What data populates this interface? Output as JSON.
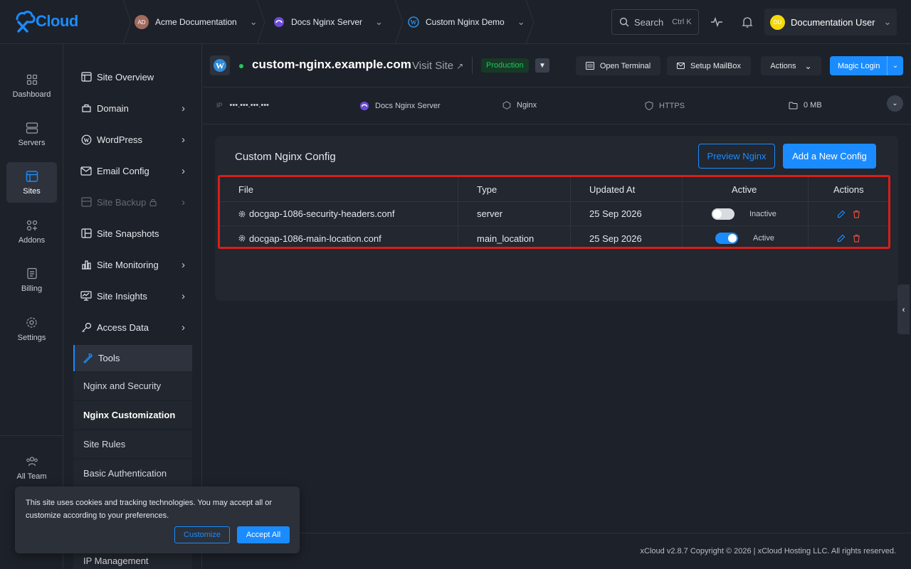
{
  "brand": {
    "name": "Cloud"
  },
  "topbar": {
    "breadcrumbs": [
      {
        "label": "Acme Documentation",
        "avatar": "AD"
      },
      {
        "label": "Docs Nginx Server"
      },
      {
        "label": "Custom Nginx Demo"
      }
    ],
    "search": {
      "label": "Search",
      "shortcut": "Ctrl K"
    },
    "user": {
      "name": "Documentation User",
      "initials": "DU"
    }
  },
  "rail": [
    {
      "label": "Dashboard"
    },
    {
      "label": "Servers"
    },
    {
      "label": "Sites"
    },
    {
      "label": "Addons"
    },
    {
      "label": "Billing"
    },
    {
      "label": "Settings"
    },
    {
      "label": "All Team"
    }
  ],
  "subnav": {
    "items": [
      {
        "label": "Site Overview"
      },
      {
        "label": "Domain"
      },
      {
        "label": "WordPress"
      },
      {
        "label": "Email Config"
      },
      {
        "label": "Site Backup"
      },
      {
        "label": "Site Snapshots"
      },
      {
        "label": "Site Monitoring"
      },
      {
        "label": "Site Insights"
      },
      {
        "label": "Access Data"
      },
      {
        "label": "Tools"
      }
    ],
    "tools_children": [
      "Nginx and Security",
      "Nginx Customization",
      "Site Rules",
      "Basic Authentication",
      "IP Management"
    ]
  },
  "site": {
    "name": "custom-nginx.example.com",
    "visit_label": "Visit Site",
    "environment": "Production",
    "buttons": {
      "terminal": "Open Terminal",
      "mailbox": "Setup MailBox",
      "actions": "Actions",
      "magic_login": "Magic Login"
    },
    "info": {
      "ip_label": "IP",
      "ip_value": "•••.•••.•••.•••",
      "server": "Docs Nginx Server",
      "webserver": "Nginx",
      "https": "HTTPS",
      "size": "0 MB"
    }
  },
  "config": {
    "title": "Custom Nginx Config",
    "preview_label": "Preview Nginx",
    "add_label": "Add a New Config",
    "columns": [
      "File",
      "Type",
      "Updated At",
      "Active",
      "Actions"
    ],
    "rows": [
      {
        "file": "docgap-1086-security-headers.conf",
        "type": "server",
        "updated": "25 Sep 2026",
        "active": false,
        "status": "Inactive"
      },
      {
        "file": "docgap-1086-main-location.conf",
        "type": "main_location",
        "updated": "25 Sep 2026",
        "active": true,
        "status": "Active"
      }
    ]
  },
  "footer": {
    "text": "xCloud v2.8.7 Copyright © 2026 | xCloud Hosting LLC. All rights reserved."
  },
  "cookie": {
    "text": "This site uses cookies and tracking technologies. You may accept all or customize according to your preferences.",
    "customize_label": "Customize",
    "accept_label": "Accept All"
  },
  "colors": {
    "accent": "#1a8cff",
    "success": "#22c55e",
    "danger": "#d91e18",
    "background": "#1d2129"
  }
}
